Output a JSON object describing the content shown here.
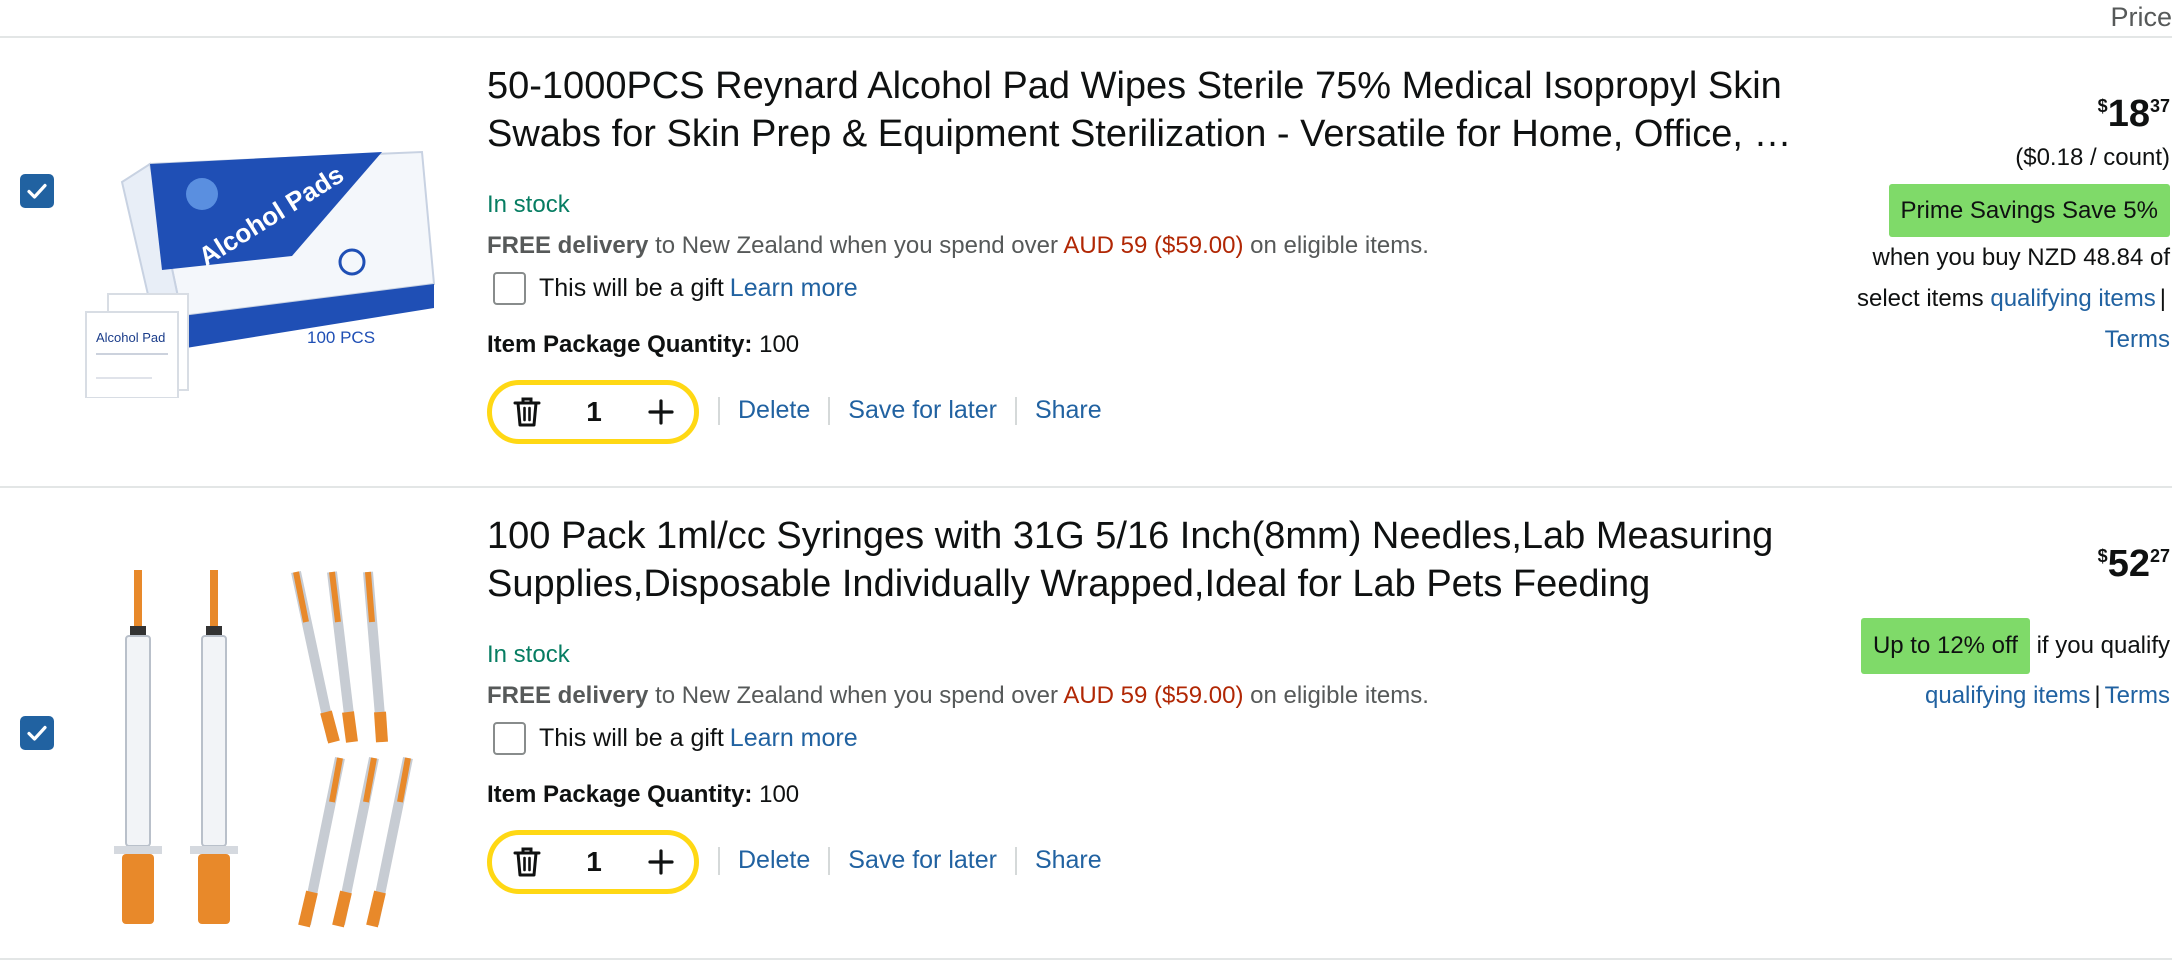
{
  "header": {
    "price_label": "Price"
  },
  "items": [
    {
      "selected": true,
      "title_line1": "50-1000PCS Reynard Alcohol Pad Wipes Sterile 75% Medical Isopropyl Skin",
      "title_line2": "Swabs for Skin Prep & Equipment Sterilization - Versatile for Home, Office, a…",
      "stock": "In stock",
      "delivery_bold": "FREE delivery",
      "delivery_mid": " to New Zealand when you spend over ",
      "delivery_red": "AUD 59 ($59.00)",
      "delivery_end": " on eligible items.",
      "gift_label": "This will be a gift",
      "learn_more": "Learn more",
      "pkg_label": "Item Package Quantity:",
      "pkg_value": " 100",
      "quantity": "1",
      "delete_label": "Delete",
      "save_label": "Save for later",
      "share_label": "Share",
      "price_currency": "$",
      "price_dollars": "18",
      "price_cents": "37",
      "unit_price": "($0.18 / count)",
      "promo_badge": "Prime Savings Save 5%",
      "promo_line1": "when you buy NZD 48.84 of",
      "promo_line2": "select items",
      "qualifying": "qualifying items",
      "terms": "Terms",
      "image": {
        "box_text": "Alcohol Pads",
        "box_count": "100 PCS",
        "pad_text": "Alcohol Pad"
      }
    },
    {
      "selected": true,
      "title_line1": "100 Pack 1ml/cc Syringes with 31G 5/16 Inch(8mm) Needles,Lab Measuring",
      "title_line2": "Supplies,Disposable Individually Wrapped,Ideal for Lab Pets Feeding",
      "stock": "In stock",
      "delivery_bold": "FREE delivery",
      "delivery_mid": " to New Zealand when you spend over ",
      "delivery_red": "AUD 59 ($59.00)",
      "delivery_end": " on eligible items.",
      "gift_label": "This will be a gift",
      "learn_more": "Learn more",
      "pkg_label": "Item Package Quantity:",
      "pkg_value": " 100",
      "quantity": "1",
      "delete_label": "Delete",
      "save_label": "Save for later",
      "share_label": "Share",
      "price_currency": "$",
      "price_dollars": "52",
      "price_cents": "27",
      "promo_badge": "Up to 12% off",
      "promo_text": "if you qualify",
      "qualifying": "qualifying items",
      "terms": "Terms"
    }
  ],
  "colors": {
    "link": "#2162a1",
    "stock": "#067d62",
    "price_red": "#b12704",
    "badge_green": "#7fda69",
    "qty_border": "#ffd814",
    "checkbox": "#2162a1"
  },
  "icons": [
    "checkmark-icon",
    "trash-icon",
    "plus-icon"
  ]
}
